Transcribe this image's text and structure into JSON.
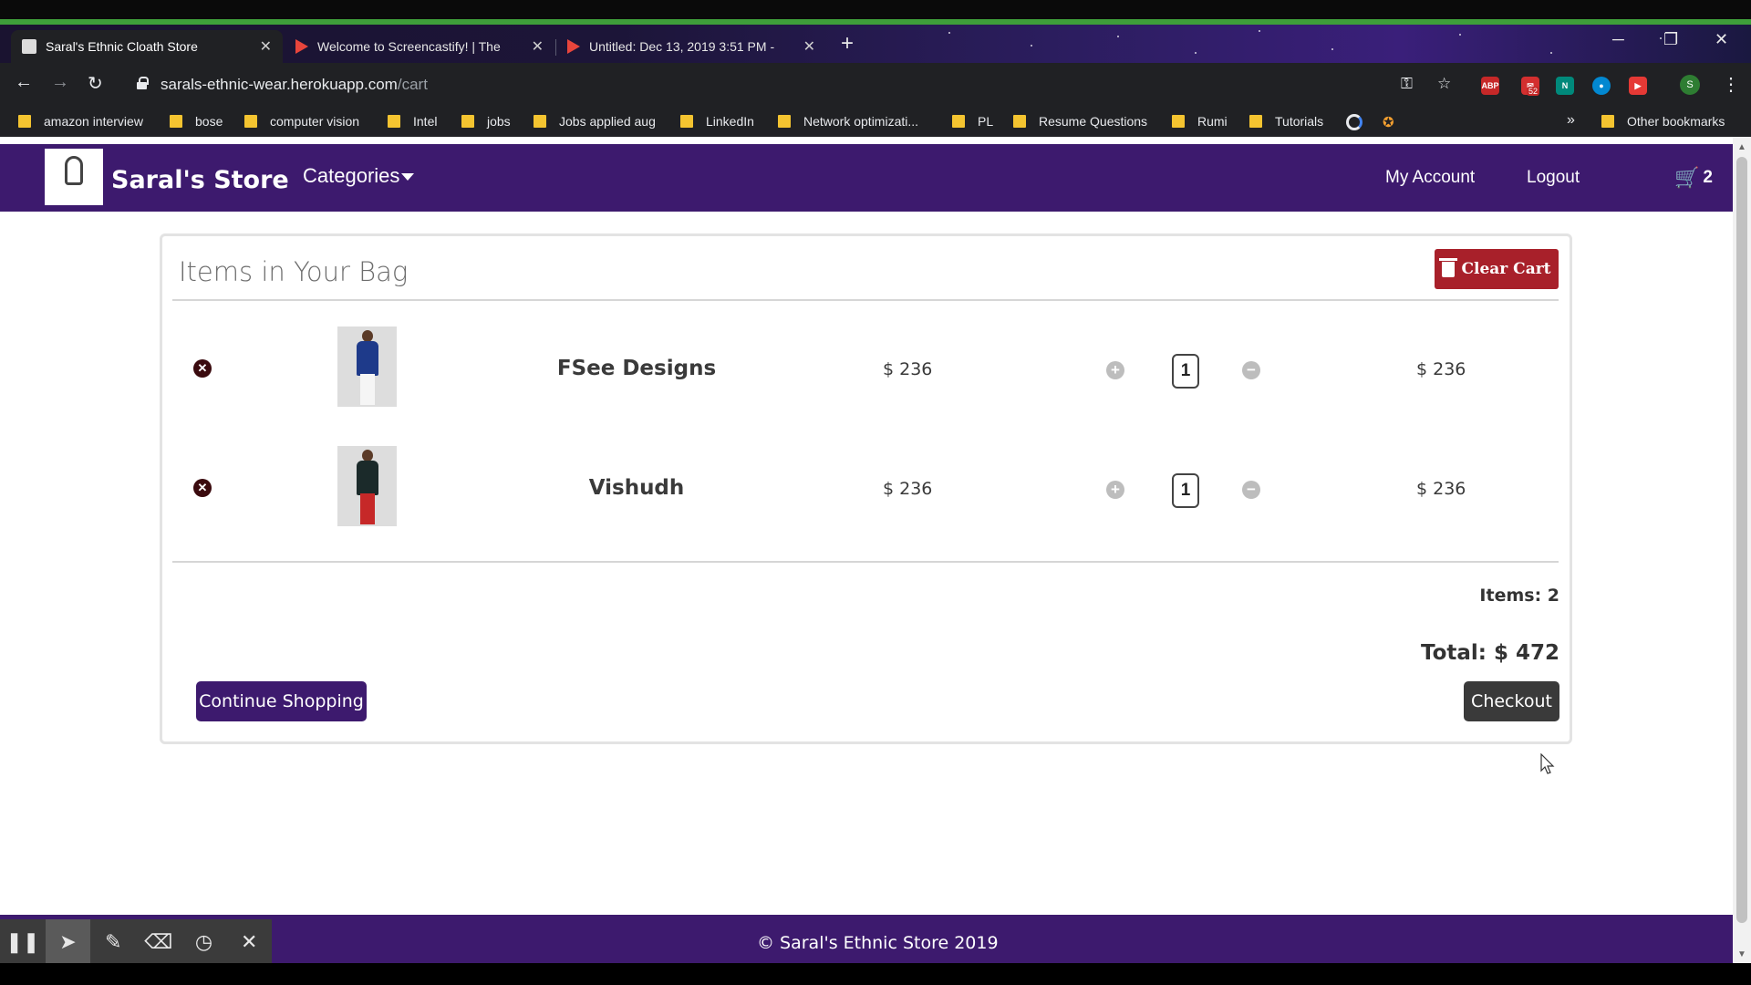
{
  "browser": {
    "tabs": [
      {
        "title": "Saral's Ethnic Cloath Store",
        "active": true
      },
      {
        "title": "Welcome to Screencastify! | The",
        "active": false
      },
      {
        "title": "Untitled: Dec 13, 2019 3:51 PM -",
        "active": false
      }
    ],
    "url_host": "sarals-ethnic-wear.herokuapp.com",
    "url_path": "/cart",
    "extension_badge": "52",
    "extensions": [
      "ABP"
    ],
    "profile_initial": "S",
    "bookmarks": [
      "amazon interview",
      "bose",
      "computer vision",
      "Intel",
      "jobs",
      "Jobs applied aug",
      "LinkedIn",
      "Network optimizati...",
      "PL",
      "Resume Questions",
      "Rumi",
      "Tutorials"
    ],
    "other_bookmarks": "Other bookmarks"
  },
  "site": {
    "brand": "Saral's Store",
    "categories": "Categories",
    "my_account": "My Account",
    "logout": "Logout",
    "cart_count": "2"
  },
  "cart": {
    "title": "Items in Your Bag",
    "clear_label": "Clear Cart",
    "items": [
      {
        "name": "FSee Designs",
        "price": "$ 236",
        "qty": "1",
        "total": "$ 236",
        "torso_color": "#1e3a8a",
        "legs_color": "#f5f5f5"
      },
      {
        "name": "Vishudh",
        "price": "$ 236",
        "qty": "1",
        "total": "$ 236",
        "torso_color": "#1b2a2a",
        "legs_color": "#c62828"
      }
    ],
    "items_count": "Items: 2",
    "total": "Total: $ 472",
    "continue_label": "Continue Shopping",
    "checkout_label": "Checkout"
  },
  "footer": {
    "text": "©   Saral's Ethnic Store 2019"
  },
  "colors": {
    "brand_purple": "#3d1a6e",
    "danger_red": "#a8202a",
    "checkout_dark": "#3a3a3a"
  }
}
